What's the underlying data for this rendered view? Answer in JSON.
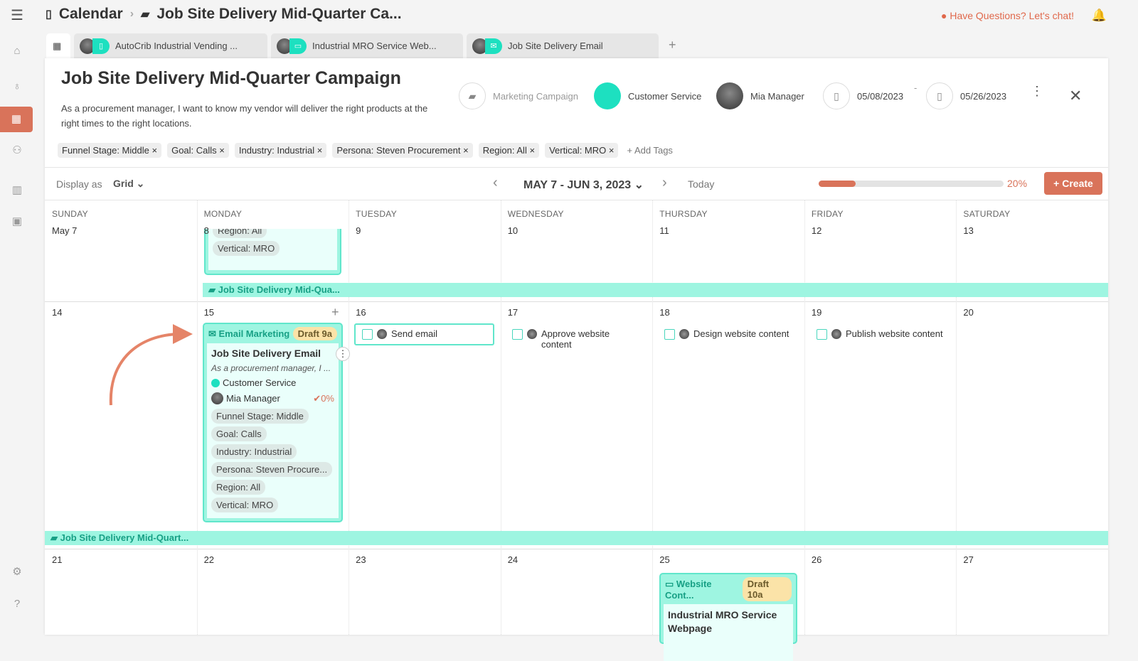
{
  "breadcrumb": {
    "root": "Calendar",
    "current": "Job Site Delivery Mid-Quarter Ca..."
  },
  "chat_link": "Have Questions? Let's chat!",
  "tabs": [
    {
      "label": "AutoCrib Industrial Vending ..."
    },
    {
      "label": "Industrial MRO Service Web..."
    },
    {
      "label": "Job Site Delivery Email"
    }
  ],
  "campaign": {
    "title": "Job Site Delivery Mid-Quarter Campaign",
    "description": "As a procurement manager, I want to know my vendor will deliver the right products at the right times to the right locations.",
    "type": "Marketing Campaign",
    "team": "Customer Service",
    "owner": "Mia Manager",
    "start_date": "05/08/2023",
    "end_date": "05/26/2023",
    "date_sep": "-",
    "team_color": "#1de0c0"
  },
  "tags": [
    "Funnel Stage: Middle",
    "Goal: Calls",
    "Industry: Industrial",
    "Persona: Steven Procurement",
    "Region: All",
    "Vertical: MRO"
  ],
  "add_tags": "+ Add Tags",
  "toolbar": {
    "display_label": "Display as",
    "display_value": "Grid",
    "range": "MAY 7 - JUN 3, 2023",
    "today": "Today",
    "progress_label": "20%",
    "progress": 20,
    "create": "Create"
  },
  "days": [
    "SUNDAY",
    "MONDAY",
    "TUESDAY",
    "WEDNESDAY",
    "THURSDAY",
    "FRIDAY",
    "SATURDAY"
  ],
  "weeks": [
    [
      "May 7",
      "8",
      "9",
      "10",
      "11",
      "12",
      "13"
    ],
    [
      "14",
      "15",
      "16",
      "17",
      "18",
      "19",
      "20"
    ],
    [
      "21",
      "22",
      "23",
      "24",
      "25",
      "26",
      "27"
    ]
  ],
  "week1_card_tail": [
    "Region: All",
    "Vertical: MRO"
  ],
  "campaign_bar_1": "Job Site Delivery Mid-Qua...",
  "campaign_bar_2": "Job Site Delivery Mid-Quart...",
  "email_card": {
    "channel": "Email Marketing",
    "status": "Draft 9a",
    "title": "Job Site Delivery Email",
    "desc": "As a procurement manager, I ...",
    "team": "Customer Service",
    "owner": "Mia Manager",
    "progress": "0%",
    "tags": [
      "Funnel Stage: Middle",
      "Goal: Calls",
      "Industry: Industrial",
      "Persona: Steven Procure...",
      "Region: All",
      "Vertical: MRO"
    ]
  },
  "tasks": [
    "Send email",
    "Approve website content",
    "Design website content",
    "Publish website content"
  ],
  "web_card": {
    "channel": "Website Cont...",
    "status": "Draft 10a",
    "title": "Industrial MRO Service Webpage"
  },
  "colors": {
    "accent": "#d9735a",
    "teal": "#1de0c0",
    "bar": "#9ef5e1"
  }
}
